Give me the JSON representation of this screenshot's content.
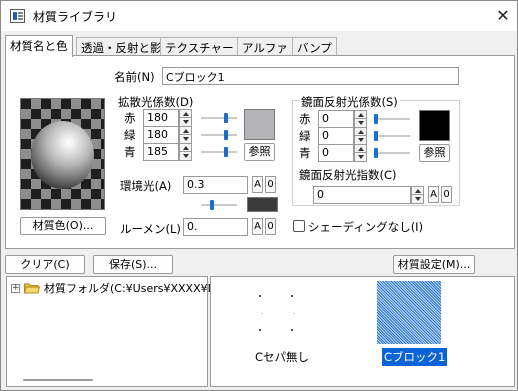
{
  "window": {
    "title": "材質ライブラリ",
    "close_label": "✕"
  },
  "tabs": [
    {
      "label": "材質名と色",
      "active": true
    },
    {
      "label": "透過・反射と影",
      "active": false
    },
    {
      "label": "テクスチャー",
      "active": false
    },
    {
      "label": "アルファ",
      "active": false
    },
    {
      "label": "バンプ",
      "active": false
    }
  ],
  "name": {
    "label": "名前(N)",
    "value": "Cブロック1"
  },
  "diffuse": {
    "title": "拡散光係数(D)",
    "rows": [
      {
        "label": "赤",
        "value": "180",
        "level": 180
      },
      {
        "label": "緑",
        "value": "180",
        "level": 180
      },
      {
        "label": "青",
        "value": "185",
        "level": 185
      }
    ],
    "swatch_color": "#b4b4b9",
    "ref_button": "参照"
  },
  "specular": {
    "title": "鏡面反射光係数(S)",
    "rows": [
      {
        "label": "赤",
        "value": "0",
        "level": 0
      },
      {
        "label": "緑",
        "value": "0",
        "level": 0
      },
      {
        "label": "青",
        "value": "0",
        "level": 0
      }
    ],
    "swatch_color": "#000000",
    "ref_button": "参照",
    "exponent_label": "鏡面反射光指数(C)",
    "exponent_value": "0",
    "exponent_a": "A",
    "exponent_zero": "0"
  },
  "ambient": {
    "label": "環境光(A)",
    "value": "0.3",
    "a": "A",
    "zero": "0",
    "swatch_color": "#3a3a3a"
  },
  "lumen": {
    "label": "ルーメン(L)",
    "value": "0.",
    "a": "A",
    "zero": "0"
  },
  "no_shading": {
    "label": "シェーディングなし(I)",
    "checked": false
  },
  "material_color_button": "材質色(O)...",
  "bottom_buttons": {
    "clear": "クリア(C)",
    "save": "保存(S)...",
    "settings": "材質設定(M)..."
  },
  "tree": {
    "expander": "+",
    "folder_label": "材質フォルダ(C:¥Users¥XXXX¥Do"
  },
  "materials": [
    {
      "name": "Cセパ無し",
      "selected": false
    },
    {
      "name": "Cブロック1",
      "selected": true
    }
  ],
  "colors": {
    "accent": "#1a6fd0",
    "selection": "#0a64d8"
  }
}
